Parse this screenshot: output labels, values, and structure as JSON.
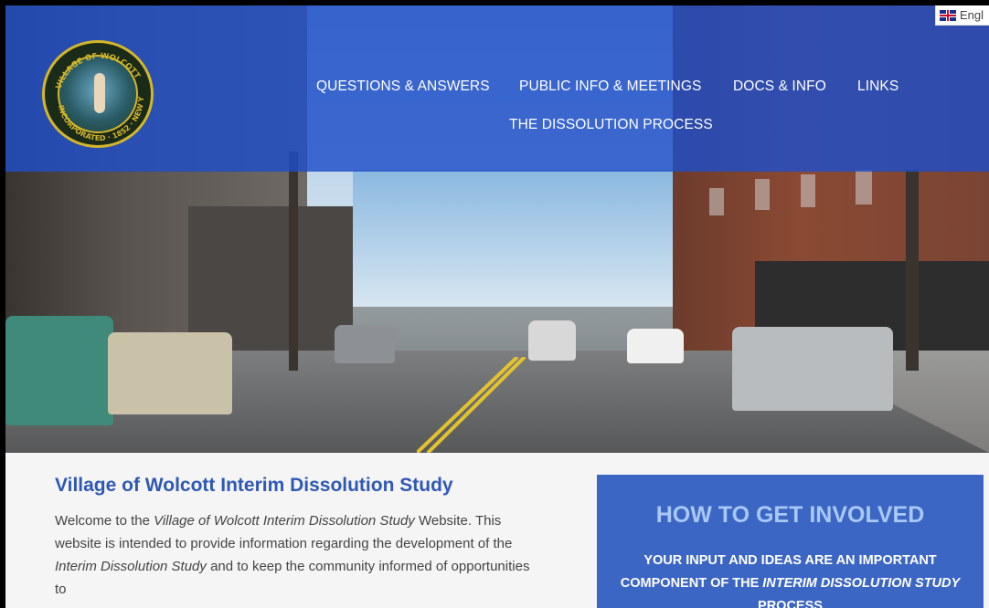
{
  "header": {
    "logo": {
      "alt_text": "VILLAGE OF WOLCOTT INCORPORATED 1852 NEW YORK"
    },
    "nav": [
      {
        "label": "QUESTIONS & ANSWERS"
      },
      {
        "label": "PUBLIC INFO & MEETINGS"
      },
      {
        "label": "DOCS & INFO"
      },
      {
        "label": "LINKS"
      },
      {
        "label": "THE DISSOLUTION PROCESS"
      }
    ],
    "language": {
      "label": "Engl",
      "icon": "uk-flag-icon"
    }
  },
  "intro": {
    "title": "Village of Wolcott Interim Dissolution Study",
    "p1": "Welcome to the ",
    "p1_em": "Village of Wolcott Interim Dissolution Study",
    "p2": " Website. This website is intended to provide information regarding the development of the ",
    "p2_em": "Interim Dissolution Study",
    "p3": " and to keep the community informed of opportunities to"
  },
  "cta": {
    "title": "HOW TO GET INVOLVED",
    "text_a": "YOUR INPUT AND IDEAS ARE AN IMPORTANT COMPONENT OF THE ",
    "text_em": "INTERIM DISSOLUTION STUDY",
    "text_b": " PROCESS"
  },
  "colors": {
    "header_blue": "#1e4ec8",
    "title_blue": "#2f58b5",
    "cta_blue": "#3c66c4",
    "cta_title": "#a9c8f6"
  }
}
